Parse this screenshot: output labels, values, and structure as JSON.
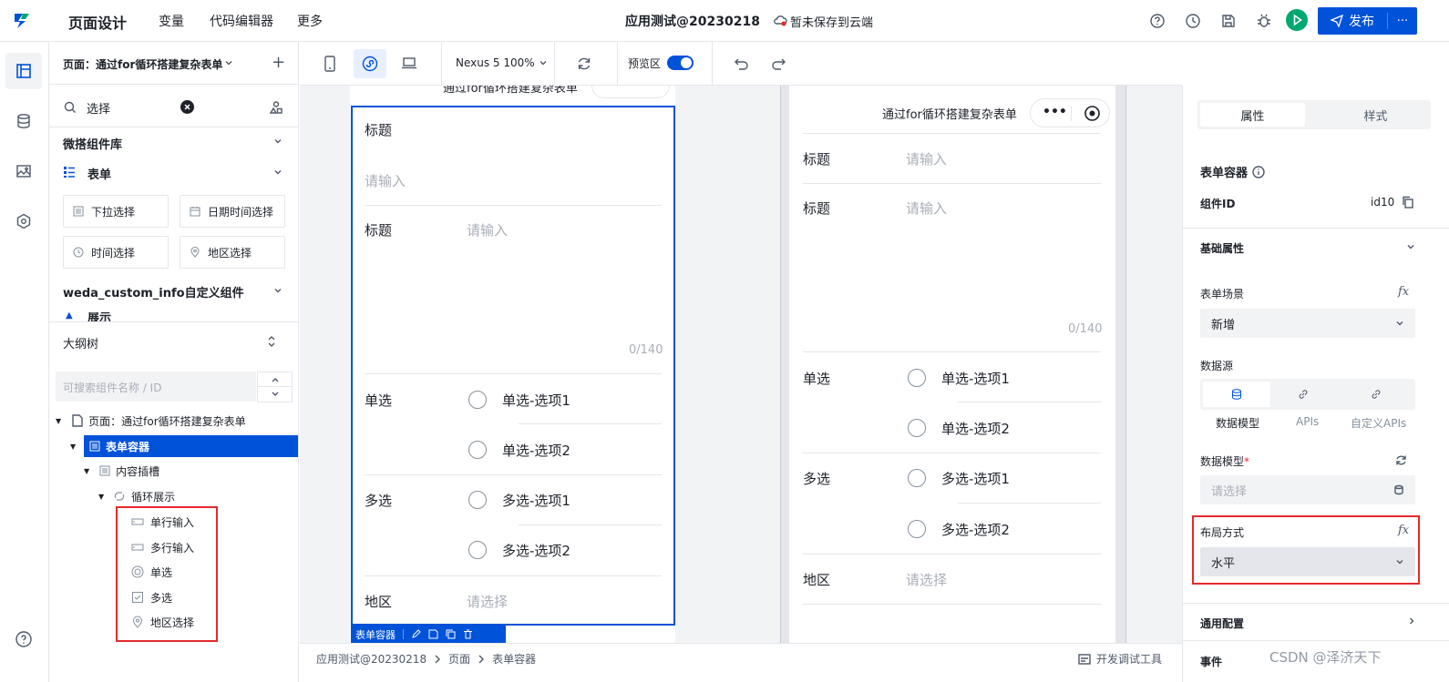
{
  "topbar": {
    "app_title": "页面设计",
    "menu": [
      "变量",
      "代码编辑器",
      "更多"
    ],
    "center_title": "应用测试@20230218",
    "save_status": "暂未保存到云端",
    "publish_label": "发布",
    "more_label": "···"
  },
  "left": {
    "page_selector": "页面：通过for循环搭建复杂表单",
    "add_label": "+",
    "search_value": "选择",
    "library_title": "微搭组件库",
    "form_group": "表单",
    "components": [
      "下拉选择",
      "日期时间选择",
      "时间选择",
      "地区选择"
    ],
    "custom_group": "weda_custom_info自定义组件",
    "custom_partial": "展示",
    "outline_title": "大纲树",
    "outline_search_placeholder": "可搜索组件名称 / ID",
    "tree": {
      "page": "页面：通过for循环搭建复杂表单",
      "form_container": "表单容器",
      "slot": "内容插槽",
      "loop": "循环展示",
      "children": [
        "单行输入",
        "多行输入",
        "单选",
        "多选",
        "地区选择"
      ]
    }
  },
  "toolbar": {
    "device": "Nexus 5 100%",
    "preview_label": "预览区"
  },
  "editor_phone": {
    "header_title": "通过for循环搭建复杂表单",
    "field1_label": "标题",
    "field1_placeholder": "请输入",
    "field2_label": "标题",
    "field2_placeholder": "请输入",
    "counter": "0/140",
    "radio_label": "单选",
    "radio_opts": [
      "单选-选项1",
      "单选-选项2"
    ],
    "check_label": "多选",
    "check_opts": [
      "多选-选项1",
      "多选-选项2"
    ],
    "region_label": "地区",
    "region_placeholder": "请选择",
    "selection_tag": "表单容器"
  },
  "preview_phone": {
    "header_title": "通过for循环搭建复杂表单",
    "field1_label": "标题",
    "field1_placeholder": "请输入",
    "field2_label": "标题",
    "field2_placeholder": "请输入",
    "counter": "0/140",
    "radio_label": "单选",
    "radio_opts": [
      "单选-选项1",
      "单选-选项2"
    ],
    "check_label": "多选",
    "check_opts": [
      "多选-选项1",
      "多选-选项2"
    ],
    "region_label": "地区",
    "region_placeholder": "请选择"
  },
  "statusbar": {
    "crumbs": [
      "应用测试@20230218",
      "页面",
      "表单容器"
    ],
    "dev_tools": "开发调试工具"
  },
  "right": {
    "tabs": [
      "属性",
      "样式"
    ],
    "component_title": "表单容器",
    "id_label": "组件ID",
    "id_value": "id10",
    "basic_props": "基础属性",
    "scene_label": "表单场景",
    "scene_value": "新增",
    "datasource_label": "数据源",
    "datasource_tabs": [
      "数据模型",
      "APIs",
      "自定义APIs"
    ],
    "model_label": "数据模型",
    "required_mark": "*",
    "model_placeholder": "请选择",
    "layout_label": "布局方式",
    "layout_value": "水平",
    "general_config": "通用配置",
    "events": "事件",
    "fx": "fx"
  },
  "watermark": "CSDN @泽济天下",
  "colors": {
    "primary": "#0052d9",
    "selected_tree": "#0052d9",
    "highlight_box": "#e5292b",
    "run_button": "#00a870"
  }
}
